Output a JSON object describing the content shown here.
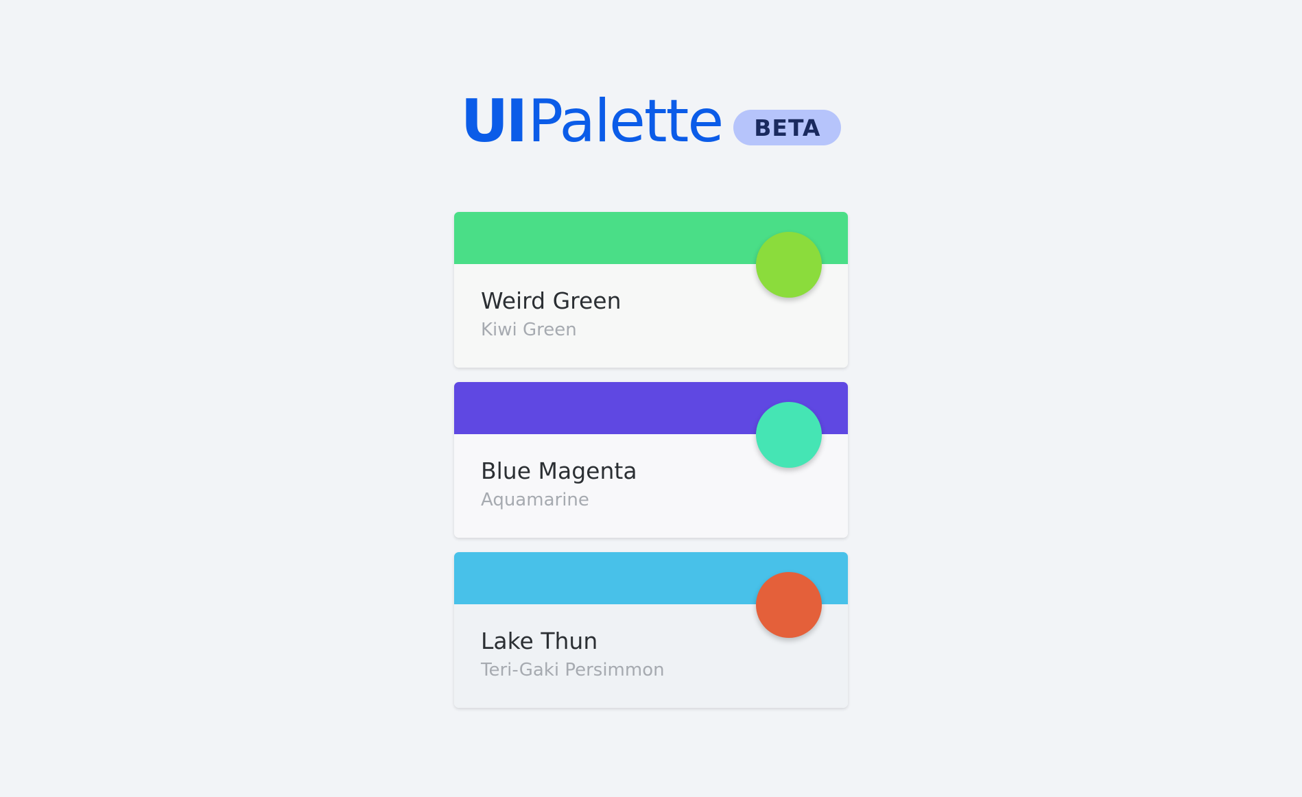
{
  "header": {
    "logo_bold": "UI",
    "logo_light": "Palette",
    "badge": "BETA",
    "logo_color": "#0b5ce8",
    "badge_bg": "#b6c4fb",
    "badge_text_color": "#1a2a5e"
  },
  "cards": [
    {
      "primary_name": "Weird Green",
      "secondary_name": "Kiwi Green",
      "primary_color": "#4ade87",
      "secondary_color": "#8bdc3c",
      "body_bg": "#f7f8f7"
    },
    {
      "primary_name": "Blue Magenta",
      "secondary_name": "Aquamarine",
      "primary_color": "#5f48e2",
      "secondary_color": "#45e5b4",
      "body_bg": "#f8f8fa"
    },
    {
      "primary_name": "Lake Thun",
      "secondary_name": "Teri-Gaki Persimmon",
      "primary_color": "#48c1e9",
      "secondary_color": "#e4603a",
      "body_bg": "#eff2f5"
    }
  ]
}
